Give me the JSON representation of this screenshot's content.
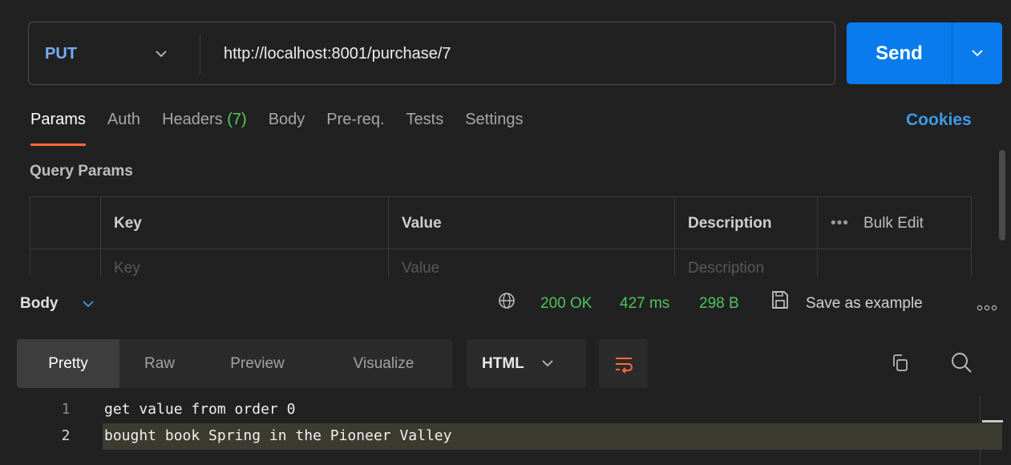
{
  "request": {
    "method": "PUT",
    "url": "http://localhost:8001/purchase/7",
    "send_label": "Send"
  },
  "request_tabs": [
    {
      "label": "Params",
      "active": true
    },
    {
      "label": "Auth"
    },
    {
      "label": "Headers",
      "badge": "(7)"
    },
    {
      "label": "Body"
    },
    {
      "label": "Pre-req."
    },
    {
      "label": "Tests"
    },
    {
      "label": "Settings"
    }
  ],
  "cookies_label": "Cookies",
  "query_params": {
    "title": "Query Params",
    "headers": {
      "key": "Key",
      "value": "Value",
      "description": "Description",
      "bulk_edit": "Bulk Edit"
    },
    "placeholders": {
      "key": "Key",
      "value": "Value",
      "description": "Description"
    }
  },
  "response": {
    "body_label": "Body",
    "status": "200 OK",
    "time": "427 ms",
    "size": "298 B",
    "save_label": "Save as example",
    "view_tabs": [
      "Pretty",
      "Raw",
      "Preview",
      "Visualize"
    ],
    "format": "HTML",
    "lines": [
      {
        "num": "1",
        "text": "get value from order 0"
      },
      {
        "num": "2",
        "text": "bought book Spring in the Pioneer Valley"
      }
    ]
  },
  "colors": {
    "accent": "#ff6c37",
    "send": "#097bed",
    "method": "#74aef6",
    "success": "#4fc45b",
    "link": "#3c9be8"
  }
}
